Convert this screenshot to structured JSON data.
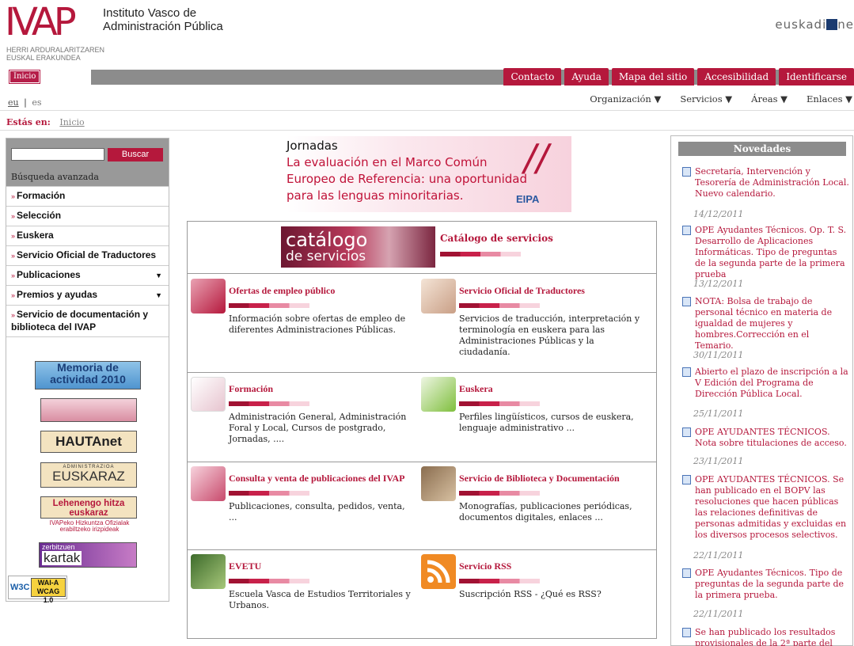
{
  "header": {
    "logo": "IVAP",
    "org_name_line1": "Instituto Vasco de",
    "org_name_line2": "Administración Pública",
    "org_sub_line1": "HERRI ARDURALARITZAREN",
    "org_sub_line2": "EUSKAL ERAKUNDEA",
    "partner_logo": "euskadi",
    "partner_logo_tail": "ne"
  },
  "nav": {
    "home": "Inicio",
    "items": [
      "Contacto",
      "Ayuda",
      "Mapa del sitio",
      "Accesibilidad",
      "Identificarse"
    ]
  },
  "lang": {
    "eu": "eu",
    "sep": "|",
    "es": "es"
  },
  "submenu": [
    "Organización",
    "Servicios",
    "Áreas",
    "Enlaces"
  ],
  "breadcrumb": {
    "label": "Estás en:",
    "link": "Inicio"
  },
  "sidebar": {
    "search_button": "Buscar",
    "advanced": "Búsqueda avanzada",
    "items": [
      "Formación",
      "Selección",
      "Euskera",
      "Servicio Oficial de Traductores",
      "Publicaciones",
      "Premios y ayudas",
      "Servicio de documentación y biblioteca del IVAP"
    ],
    "badges": {
      "memoria_1": "Memoria de",
      "memoria_2": "actividad 2010",
      "hauta": "HAUTAnet",
      "euskaraz": "EUSKARAZ",
      "euskaraz_top": "ADMINISTRAZIOA",
      "leh_1": "Lehenengo hitza",
      "leh_2": "euskaraz",
      "leh_cap_1": "IVAPeko Hizkuntza Ofizialak",
      "leh_cap_2": "erabiltzeko irizpideak",
      "kart_1": "zerbitzuen",
      "kart_2": "kartak",
      "w3c": "W3C",
      "wai_1": "WAI-A",
      "wai_2": "WCAG 1.0"
    }
  },
  "banner": {
    "line1": "Jornadas",
    "line2": "La evaluación en el Marco Común",
    "line3": "Europeo de Referencia: una oportunidad",
    "line4": "para las lenguas minoritarias.",
    "org": "EIPA"
  },
  "catalog": {
    "img_1": "catálogo",
    "img_2": "de servicios",
    "title": "Catálogo de servicios"
  },
  "services": [
    {
      "title": "Ofertas de empleo público",
      "desc": "Información sobre ofertas de empleo de diferentes Administraciones Públicas."
    },
    {
      "title": "Servicio Oficial de Traductores",
      "desc": "Servicios de traducción, interpretación y terminología en euskera para las Administraciones Públicas y la ciudadanía."
    },
    {
      "title": "Formación",
      "desc": "Administración General, Administración Foral y Local, Cursos de postgrado, Jornadas, ...."
    },
    {
      "title": "Euskera",
      "desc": "Perfiles lingüísticos, cursos de euskera, lenguaje administrativo ..."
    },
    {
      "title": "Consulta y venta de publicaciones del IVAP",
      "desc": "Publicaciones, consulta, pedidos, venta, ..."
    },
    {
      "title": "Servicio de Biblioteca y Documentación",
      "desc": "Monografías, publicaciones periódicas, documentos digitales, enlaces ..."
    },
    {
      "title": "EVETU",
      "desc": "Escuela Vasca de Estudios Territoriales y Urbanos."
    },
    {
      "title": "Servicio RSS",
      "desc": "Suscripción RSS - ¿Qué es RSS?"
    }
  ],
  "news": {
    "title": "Novedades",
    "items": [
      {
        "text": "Secretaría, Intervención y Tesorería de Administración Local. Nuevo calendario.",
        "date": "14/12/2011"
      },
      {
        "text": "OPE Ayudantes Técnicos. Op. T. S. Desarrollo de Aplicaciones Informáticas. Tipo de preguntas de la segunda parte de la primera prueba",
        "date": "13/12/2011"
      },
      {
        "text": "NOTA: Bolsa de trabajo de personal técnico en materia de igualdad de mujeres y hombres.Corrección en el Temario.",
        "date": "30/11/2011"
      },
      {
        "text": "Abierto el plazo de inscripción a la V Edición del Programa de Dirección Pública Local.",
        "date": "25/11/2011"
      },
      {
        "text": "OPE AYUDANTES TÉCNICOS. Nota sobre titulaciones de acceso.",
        "date": "23/11/2011"
      },
      {
        "text": "OPE AYUDANTES TÉCNICOS. Se han publicado en el BOPV las resoluciones que hacen públicas las relaciones definitivas de personas admitidas y excluidas en los diversos procesos selectivos.",
        "date": "22/11/2011"
      },
      {
        "text": "OPE Ayudantes Técnicos. Tipo de preguntas de la segunda parte de la primera prueba.",
        "date": "22/11/2011"
      },
      {
        "text": "Se han publicado los resultados provisionales de la 2ª parte del",
        "date": ""
      }
    ]
  }
}
